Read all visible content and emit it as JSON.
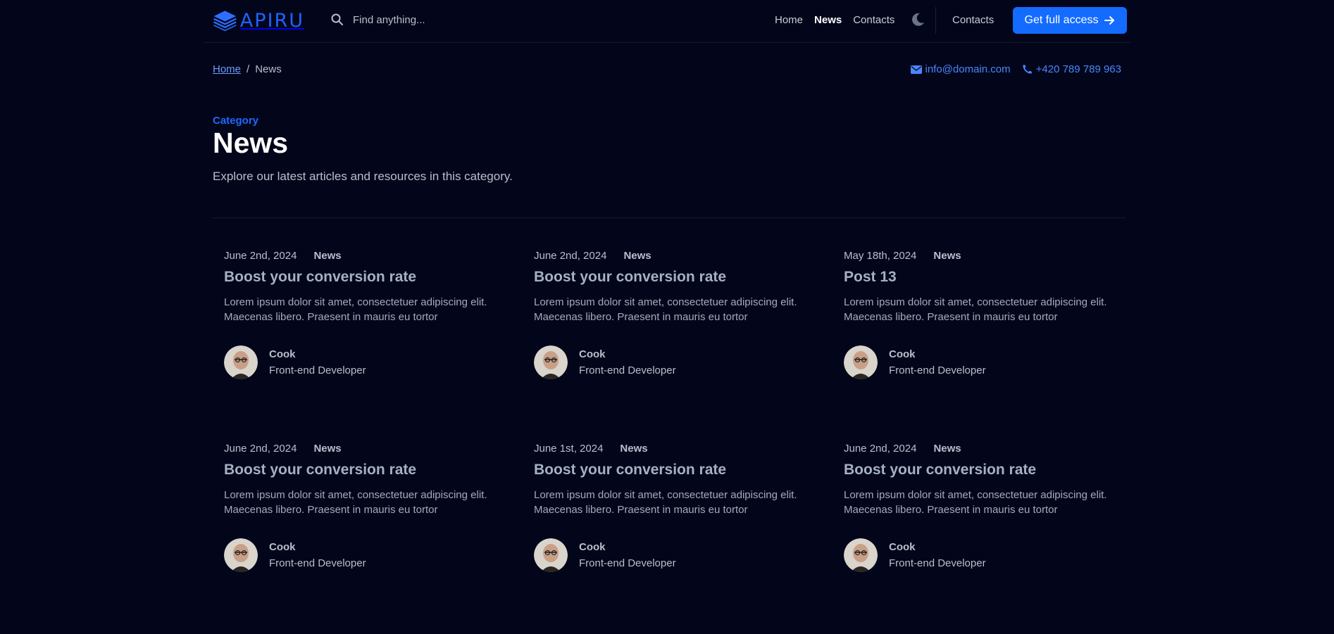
{
  "header": {
    "logo_text": "APIRU",
    "search_placeholder": "Find anything...",
    "nav": [
      {
        "label": "Home"
      },
      {
        "label": "News"
      },
      {
        "label": "Contacts"
      }
    ],
    "active_nav": "News",
    "contacts_label": "Contacts",
    "cta_label": "Get full access"
  },
  "breadcrumb": {
    "home": "Home",
    "separator": "/",
    "current": "News"
  },
  "contact": {
    "email": "info@domain.com",
    "phone": "+420 789 789 963"
  },
  "category": {
    "label": "Category",
    "title": "News",
    "description": "Explore our latest articles and resources in this category."
  },
  "posts": [
    {
      "date": "June 2nd, 2024",
      "category": "News",
      "title": "Boost your conversion rate",
      "excerpt_line1": "Lorem ipsum dolor sit amet, consectetuer adipiscing elit.",
      "excerpt_line2": "Maecenas libero. Praesent in mauris eu tortor",
      "author": "Cook",
      "role": "Front-end Developer"
    },
    {
      "date": "June 2nd, 2024",
      "category": "News",
      "title": "Boost your conversion rate",
      "excerpt_line1": "Lorem ipsum dolor sit amet, consectetuer adipiscing elit.",
      "excerpt_line2": "Maecenas libero. Praesent in mauris eu tortor",
      "author": "Cook",
      "role": "Front-end Developer"
    },
    {
      "date": "May 18th, 2024",
      "category": "News",
      "title": "Post 13",
      "excerpt_line1": "Lorem ipsum dolor sit amet, consectetuer adipiscing elit.",
      "excerpt_line2": "Maecenas libero. Praesent in mauris eu tortor",
      "author": "Cook",
      "role": "Front-end Developer"
    },
    {
      "date": "June 2nd, 2024",
      "category": "News",
      "title": "Boost your conversion rate",
      "excerpt_line1": "Lorem ipsum dolor sit amet, consectetuer adipiscing elit.",
      "excerpt_line2": "Maecenas libero. Praesent in mauris eu tortor",
      "author": "Cook",
      "role": "Front-end Developer"
    },
    {
      "date": "June 1st, 2024",
      "category": "News",
      "title": "Boost your conversion rate",
      "excerpt_line1": "Lorem ipsum dolor sit amet, consectetuer adipiscing elit.",
      "excerpt_line2": "Maecenas libero. Praesent in mauris eu tortor",
      "author": "Cook",
      "role": "Front-end Developer"
    },
    {
      "date": "June 2nd, 2024",
      "category": "News",
      "title": "Boost your conversion rate",
      "excerpt_line1": "Lorem ipsum dolor sit amet, consectetuer adipiscing elit.",
      "excerpt_line2": "Maecenas libero. Praesent in mauris eu tortor",
      "author": "Cook",
      "role": "Front-end Developer"
    }
  ],
  "colors": {
    "background": "#03061a",
    "accent": "#146bff",
    "link": "#4a86ff"
  },
  "icons": [
    "logo-icon",
    "search-icon",
    "moon-icon",
    "arrow-right-icon",
    "envelope-icon",
    "phone-icon"
  ]
}
